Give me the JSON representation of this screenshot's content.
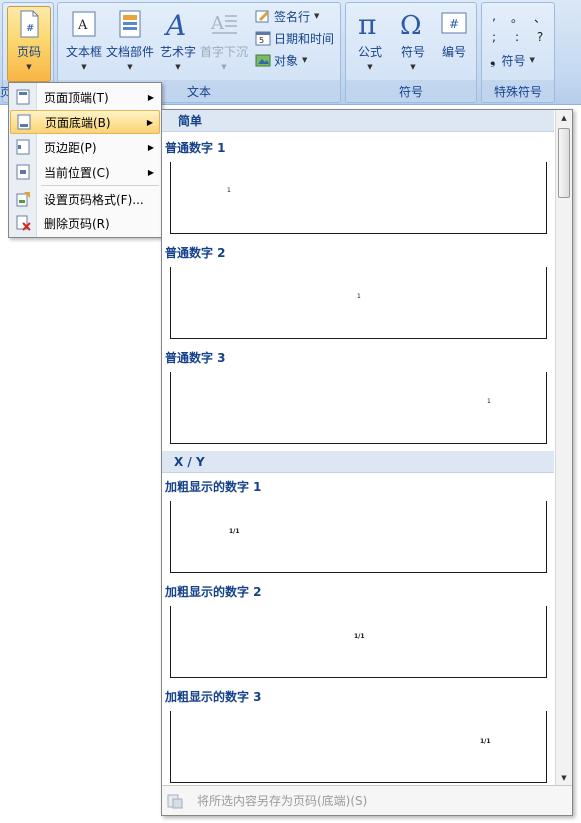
{
  "ribbon": {
    "page_number": "页码",
    "text_group": {
      "label": "文本",
      "textbox": "文本框",
      "quickparts": "文档部件",
      "wordart": "艺术字",
      "dropcap": "首字下沉",
      "signature_line": "签名行",
      "date_time": "日期和时间",
      "object": "对象"
    },
    "symbols_group": {
      "label": "符号",
      "equation": "公式",
      "symbol": "符号",
      "number": "编号"
    },
    "special_group": {
      "label": "特殊符号",
      "symbol": "符号",
      "cells": [
        ",",
        "。",
        "、",
        ";",
        ":",
        "?"
      ]
    },
    "left_edge_label": "页"
  },
  "menu": {
    "items": [
      {
        "label": "页面顶端(T)"
      },
      {
        "label": "页面底端(B)"
      },
      {
        "label": "页边距(P)"
      },
      {
        "label": "当前位置(C)"
      },
      {
        "label": "设置页码格式(F)..."
      },
      {
        "label": "删除页码(R)"
      }
    ]
  },
  "gallery": {
    "sections": [
      {
        "header": "简单",
        "items": [
          {
            "title": "普通数字 1",
            "sample": "1"
          },
          {
            "title": "普通数字 2",
            "sample": "1"
          },
          {
            "title": "普通数字 3",
            "sample": "1"
          }
        ]
      },
      {
        "header": "X / Y",
        "items": [
          {
            "title": "加粗显示的数字 1",
            "sample": "1/1"
          },
          {
            "title": "加粗显示的数字 2",
            "sample": "1/1"
          },
          {
            "title": "加粗显示的数字 3",
            "sample": "1/1"
          }
        ]
      }
    ],
    "footer": "将所选内容另存为页码(底端)(S)"
  },
  "colors": {
    "accent_text": "#15428b",
    "highlight": "#fbd475",
    "ribbon_bg": "#c5d9f1"
  }
}
